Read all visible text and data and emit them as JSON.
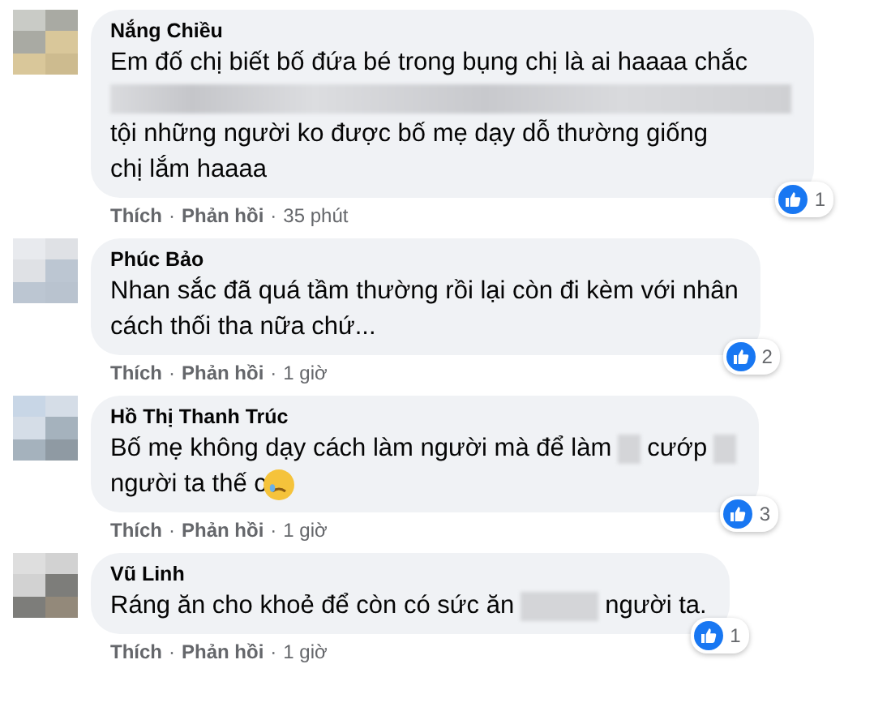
{
  "comments": [
    {
      "author": "Nắng Chiều",
      "lines": [
        [
          {
            "kind": "text",
            "text": "Em đố chị biết bố đứa bé trong bụng chị là ai haaaa chắc"
          }
        ],
        [
          {
            "kind": "redacted_line"
          }
        ],
        [
          {
            "kind": "text",
            "text": "tội những người ko được bố mẹ dạy dỗ thường giống"
          }
        ],
        [
          {
            "kind": "text",
            "text": "chị lắm haaaa"
          }
        ]
      ],
      "likes": "1",
      "actions": [
        {
          "kind": "link",
          "text": "Thích"
        },
        {
          "kind": "dot",
          "text": "·"
        },
        {
          "kind": "link",
          "text": "Phản hồi"
        },
        {
          "kind": "dot",
          "text": "·"
        },
        {
          "kind": "time",
          "text": "35 phút"
        }
      ]
    },
    {
      "author": "Phúc Bảo",
      "lines": [
        [
          {
            "kind": "text",
            "text": "Nhan sắc đã quá tầm thường rồi lại còn đi kèm với nhân"
          }
        ],
        [
          {
            "kind": "text",
            "text": "cách thối tha nữa chứ..."
          }
        ]
      ],
      "likes": "2",
      "actions": [
        {
          "kind": "link",
          "text": "Thích"
        },
        {
          "kind": "dot",
          "text": "·"
        },
        {
          "kind": "link",
          "text": "Phản hồi"
        },
        {
          "kind": "dot",
          "text": "·"
        },
        {
          "kind": "time",
          "text": "1 giờ"
        }
      ]
    },
    {
      "author": "Hồ Thị Thanh Trúc",
      "lines": [
        [
          {
            "kind": "text",
            "text": "Bố mẹ không dạy cách làm người mà để làm"
          },
          {
            "kind": "redacted"
          },
          {
            "kind": "text",
            "text": "cướp"
          },
          {
            "kind": "redacted"
          }
        ],
        [
          {
            "kind": "text",
            "text": "người ta thế c"
          },
          {
            "kind": "emoji"
          }
        ]
      ],
      "likes": "3",
      "actions": [
        {
          "kind": "link",
          "text": "Thích"
        },
        {
          "kind": "dot",
          "text": "·"
        },
        {
          "kind": "link",
          "text": "Phản hồi"
        },
        {
          "kind": "dot",
          "text": "·"
        },
        {
          "kind": "time",
          "text": "1 giờ"
        }
      ]
    },
    {
      "author": "Vũ Linh",
      "lines": [
        [
          {
            "kind": "text",
            "text": "Ráng ăn cho khoẻ để còn có sức ăn"
          },
          {
            "kind": "redacted_word"
          },
          {
            "kind": "text",
            "text": "người ta."
          }
        ]
      ],
      "likes": "1",
      "actions": [
        {
          "kind": "link",
          "text": "Thích"
        },
        {
          "kind": "dot",
          "text": "·"
        },
        {
          "kind": "link",
          "text": "Phản hồi"
        },
        {
          "kind": "dot",
          "text": "·"
        },
        {
          "kind": "time",
          "text": "1 giờ"
        }
      ]
    }
  ]
}
